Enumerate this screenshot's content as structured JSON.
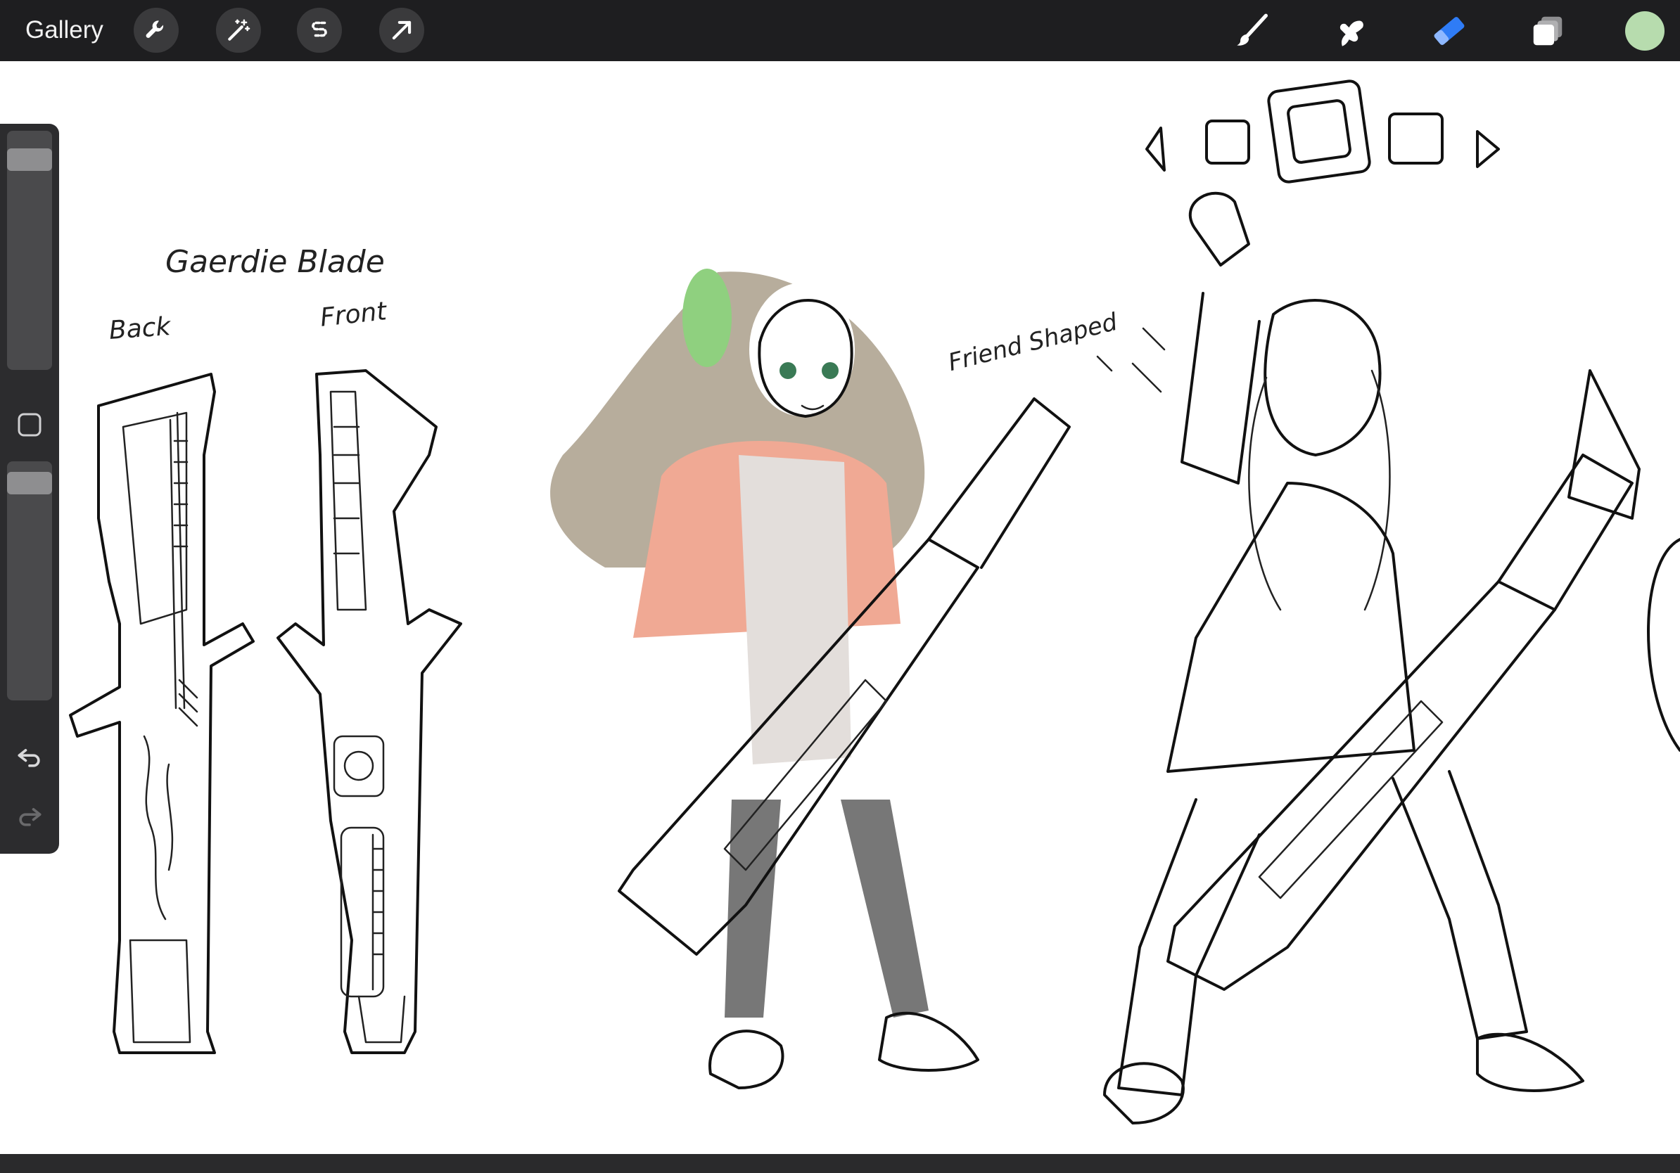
{
  "toolbar": {
    "gallery_label": "Gallery",
    "left_tools": [
      "wrench-icon",
      "magic-wand-icon",
      "selection-s-icon",
      "transform-arrow-icon"
    ],
    "right_tools": [
      "brush-icon",
      "smudge-icon",
      "eraser-icon",
      "layers-icon"
    ],
    "active_tool": "eraser-icon",
    "active_color": "#b7dcae",
    "accent": "#2f7cf6"
  },
  "sidebar": {
    "size_level": 0.92,
    "opacity_level": 0.95
  },
  "canvas": {
    "annotations": {
      "title": "Gaerdie Blade",
      "back": "Back",
      "front": "Front",
      "note": "Friend Shaped"
    }
  }
}
